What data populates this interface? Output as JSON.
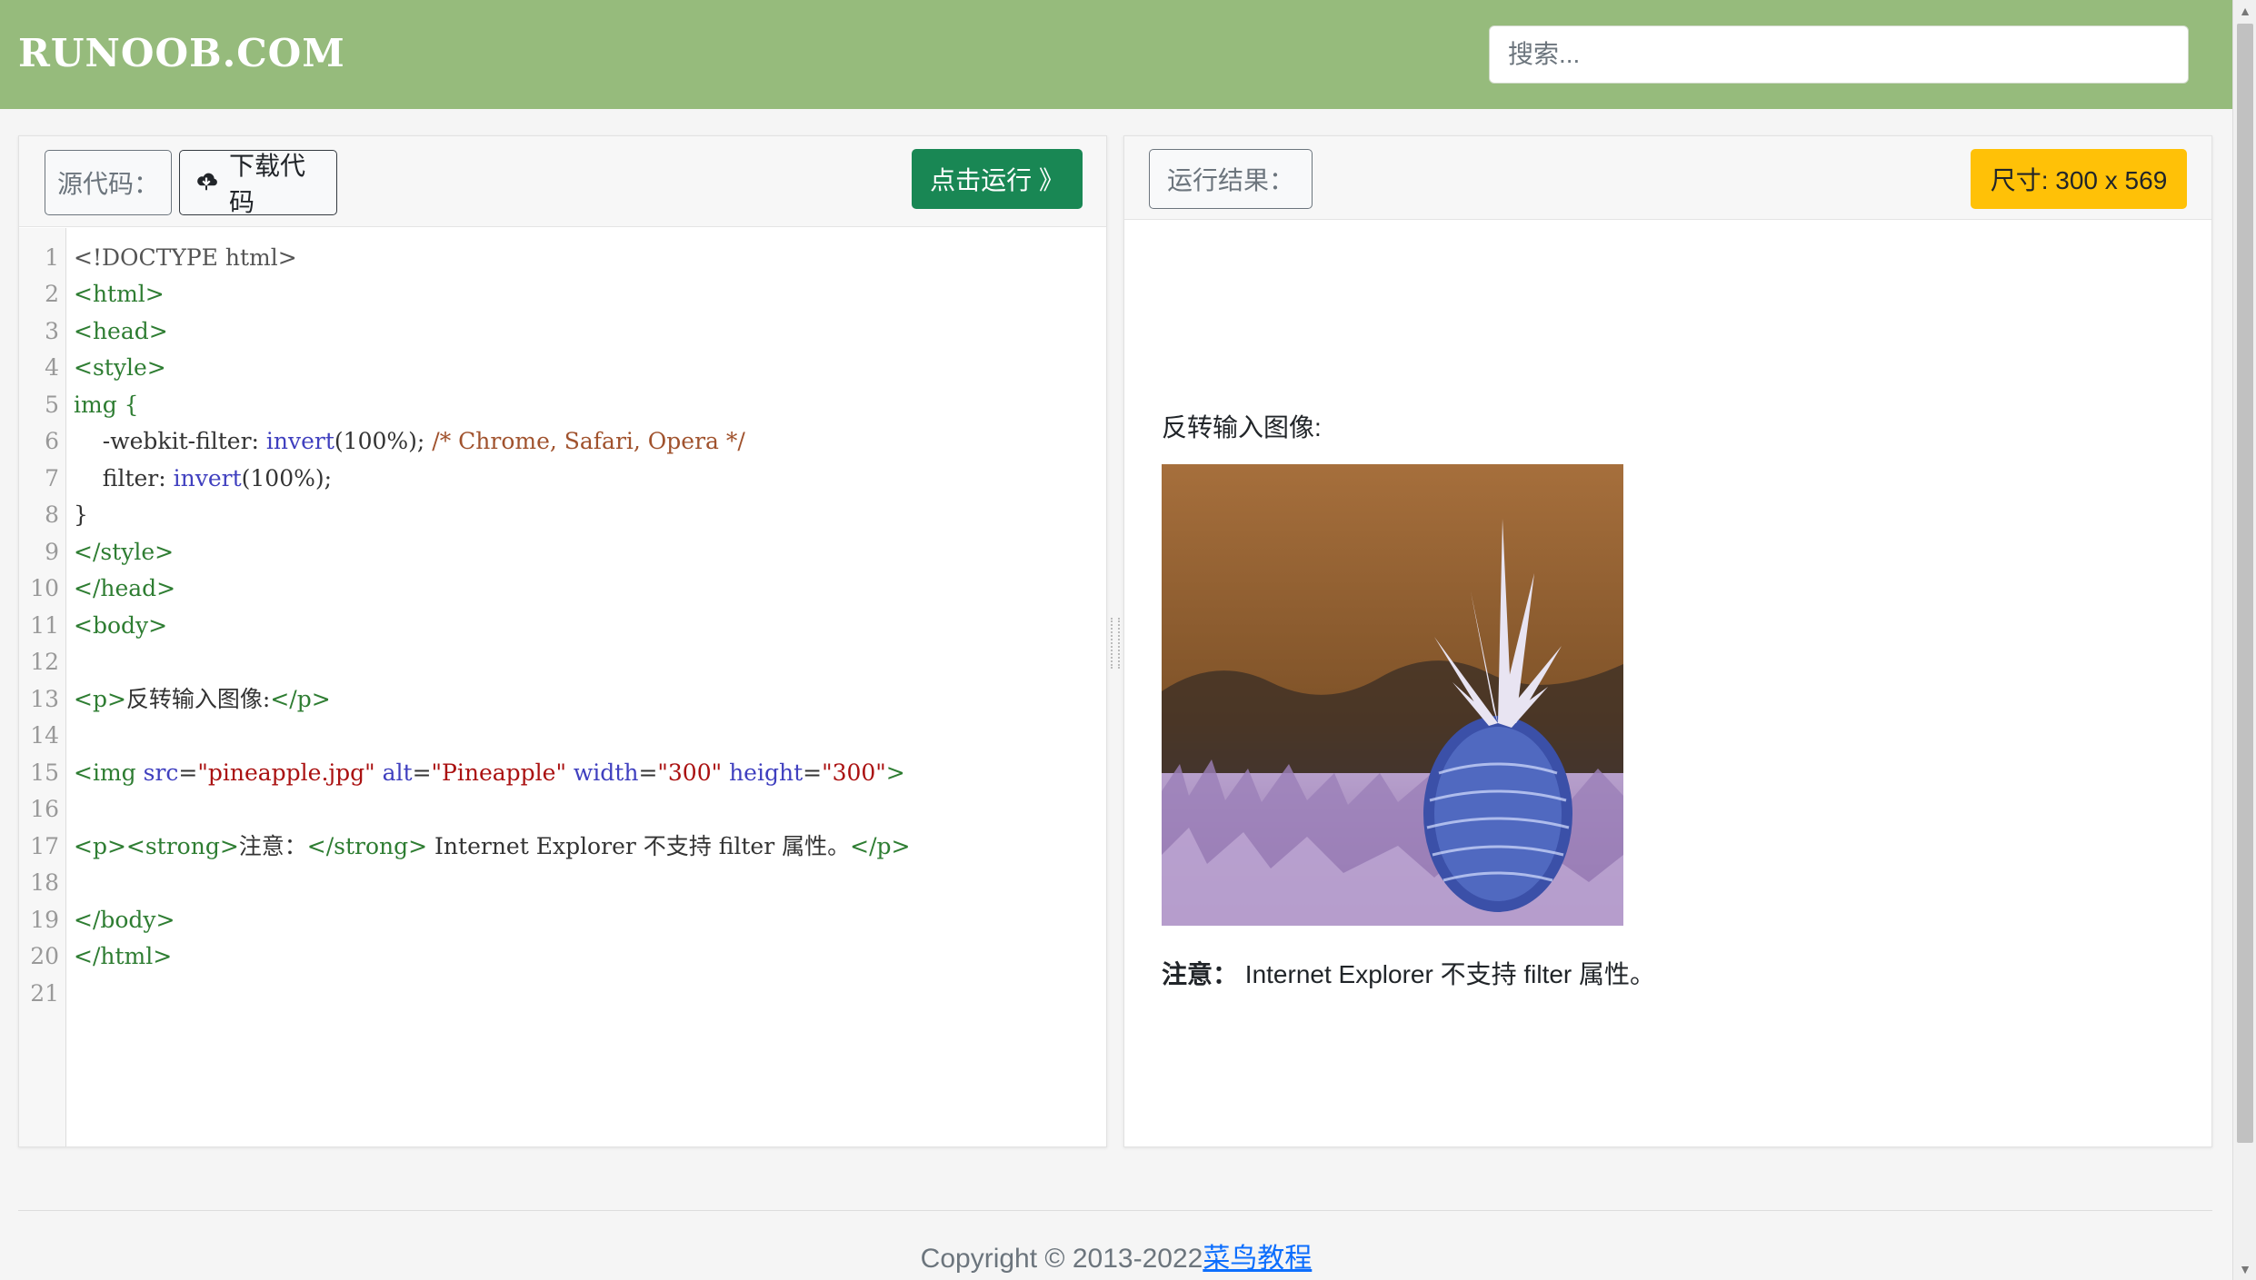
{
  "header": {
    "logo": "RUNOOB.COM",
    "search_placeholder": "搜索..."
  },
  "editor": {
    "source_label": "源代码：",
    "download_label": "下载代码",
    "run_label": "点击运行 》",
    "line_numbers": [
      "1",
      "2",
      "3",
      "4",
      "5",
      "6",
      "7",
      "8",
      "9",
      "10",
      "11",
      "12",
      "13",
      "14",
      "15",
      "16",
      "17",
      "18",
      "19",
      "20",
      "21"
    ],
    "code": {
      "l1": "<!DOCTYPE html>",
      "l2": "<html>",
      "l3": "<head>",
      "l4": "<style>",
      "l5": "img {",
      "l6a": "    -webkit-filter: ",
      "l6b": "invert",
      "l6c": "(100%); ",
      "l6d": "/* Chrome, Safari, Opera */",
      "l7a": "    filter: ",
      "l7b": "invert",
      "l7c": "(100%);",
      "l8": "}",
      "l9": "</style>",
      "l10": "</head>",
      "l11": "<body>",
      "l13a": "<p>",
      "l13b": "反转输入图像:",
      "l13c": "</p>",
      "l15a": "<img ",
      "l15b": "src",
      "l15c": "=",
      "l15d": "\"pineapple.jpg\"",
      "l15e": " alt",
      "l15f": "\"Pineapple\"",
      "l15g": " width",
      "l15h": "\"300\"",
      "l15i": " height",
      "l15j": "\"300\"",
      "l15k": ">",
      "l17a": "<p><strong>",
      "l17b": "注意：",
      "l17c": "</strong>",
      "l17d": " Internet Explorer 不支持 filter 属性。",
      "l17e": "</p>",
      "l19": "</body>",
      "l20": "</html>"
    }
  },
  "result": {
    "label": "运行结果：",
    "size": "尺寸: 300 x 569",
    "heading": "反转输入图像:",
    "note_bold": "注意：",
    "note_text": " Internet Explorer 不支持 filter 属性。"
  },
  "footer": {
    "copyright": "Copyright © 2013-2022",
    "link": "菜鸟教程"
  }
}
